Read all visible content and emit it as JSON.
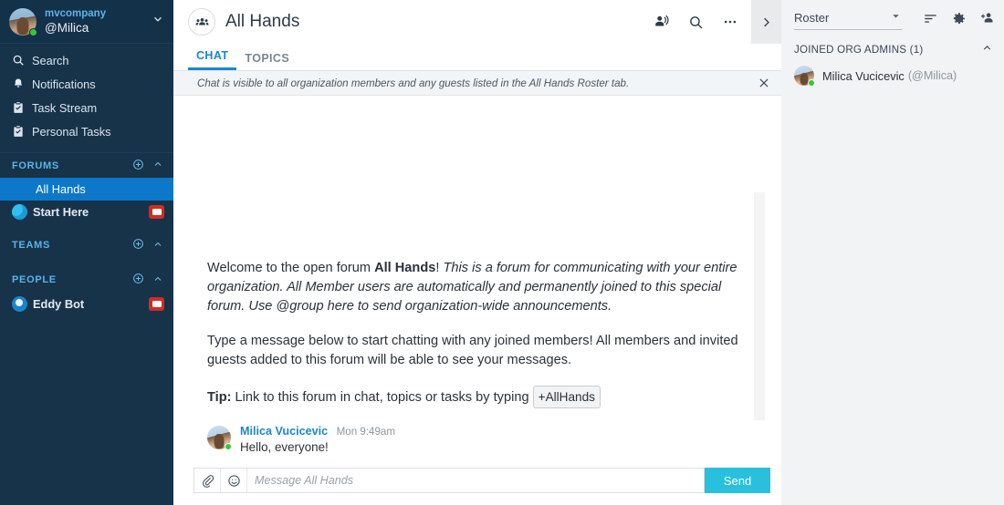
{
  "sidebar": {
    "org_name": "mvcompany",
    "user_handle": "@Milica",
    "expand_icon": "chevron-down-icon",
    "nav": [
      {
        "label": "Search",
        "icon": "search-icon"
      },
      {
        "label": "Notifications",
        "icon": "bell-icon"
      },
      {
        "label": "Task Stream",
        "icon": "clipboard-check-icon"
      },
      {
        "label": "Personal Tasks",
        "icon": "clipboard-check-icon"
      }
    ],
    "groups": [
      {
        "label": "FORUMS",
        "add_icon": "plus-circle-icon",
        "collapse_icon": "chevron-up-icon"
      },
      {
        "label": "TEAMS",
        "add_icon": "plus-circle-icon",
        "collapse_icon": "chevron-up-icon"
      },
      {
        "label": "PEOPLE",
        "add_icon": "plus-circle-icon",
        "collapse_icon": "chevron-up-icon"
      }
    ],
    "forums": [
      {
        "label": "All Hands",
        "active": true,
        "badge": false
      },
      {
        "label": "Start Here",
        "active": false,
        "badge": true,
        "icon": "forum-avatar-icon"
      }
    ],
    "people": [
      {
        "label": "Eddy Bot",
        "badge": true,
        "icon": "bot-avatar-icon"
      }
    ]
  },
  "header": {
    "title": "All Hands",
    "forum_icon": "people-group-icon",
    "icons": [
      {
        "name": "notify-person-icon"
      },
      {
        "name": "search-icon"
      },
      {
        "name": "ellipsis-icon"
      }
    ],
    "panel_toggle_icon": "chevron-right-icon"
  },
  "tabs": [
    {
      "label": "CHAT",
      "active": true
    },
    {
      "label": "TOPICS",
      "active": false
    }
  ],
  "notice": {
    "text": "Chat is visible to all organization members and any guests listed in the All Hands Roster tab.",
    "close_icon": "close-icon"
  },
  "chat": {
    "welcome_lead": "Welcome to the open forum ",
    "welcome_bold": "All Hands",
    "welcome_bang": "! ",
    "welcome_italic": "This is a forum for communicating with your entire organization. All Member users are automatically and permanently joined to this special forum. Use @group here to send organization-wide announcements.",
    "welcome_second": "Type a message below to start chatting with any joined members! All members and invited guests added to this forum will be able to see your messages.",
    "tip_label": "Tip:",
    "tip_text": " Link to this forum in chat, topics or tasks by typing ",
    "tip_chip": "+AllHands",
    "messages": [
      {
        "author": "Milica Vucicevic",
        "time": "Mon 9:49am",
        "text": "Hello, everyone!"
      }
    ]
  },
  "composer": {
    "attach_icon": "paperclip-icon",
    "emoji_icon": "emoji-smiley-icon",
    "placeholder": "Message All Hands",
    "value": "",
    "send_label": "Send"
  },
  "right_panel": {
    "select_value": "Roster",
    "select_caret_icon": "chevron-down-icon",
    "icons": [
      {
        "name": "sort-lines-icon"
      },
      {
        "name": "gear-icon"
      },
      {
        "name": "add-people-icon"
      }
    ],
    "section_title": "JOINED ORG ADMINS (1)",
    "section_collapse_icon": "chevron-up-icon",
    "members": [
      {
        "name": "Milica Vucicevic",
        "handle": "(@Milica)"
      }
    ]
  },
  "colors": {
    "sidebar_bg": "#173349",
    "sidebar_active": "#0d78c9",
    "accent_blue": "#1b86d4",
    "send_cyan": "#29c0de",
    "badge_red": "#d42b20",
    "presence_green": "#35c83a",
    "right_panel_bg": "#f2f3f5"
  }
}
